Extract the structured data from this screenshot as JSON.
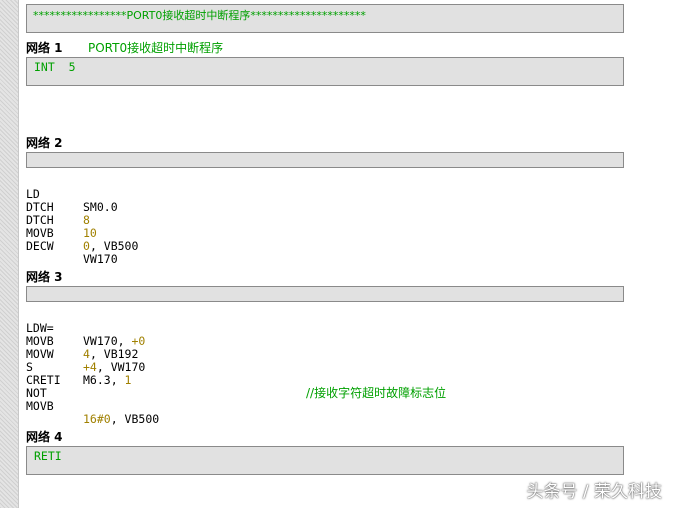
{
  "title_comment": "*****************PORT0接收超时中断程序*********************",
  "networks": [
    {
      "label": "网络 1",
      "comment": "PORT0接收超时中断程序",
      "box_text": "INT  5",
      "lines": []
    },
    {
      "label": "网络 2",
      "comment": "",
      "box_text": "",
      "lines": [
        {
          "op": "LD",
          "arg": "SM0.0"
        },
        {
          "op": "DTCH",
          "arg": "8"
        },
        {
          "op": "DTCH",
          "arg": "10"
        },
        {
          "op": "MOVB",
          "arg_num": "0",
          "arg_rest": ", VB500"
        },
        {
          "op": "DECW",
          "arg": "VW170"
        }
      ]
    },
    {
      "label": "网络 3",
      "comment": "",
      "box_text": "",
      "lines": [
        {
          "op": "LDW=",
          "arg_a": "VW170, ",
          "arg_b": "+0"
        },
        {
          "op": "MOVB",
          "arg_num": "4",
          "arg_rest": ", VB192"
        },
        {
          "op": "MOVW",
          "arg_num": "+4",
          "arg_rest": ", VW170"
        },
        {
          "op": "S",
          "arg_a": "M6.3, ",
          "arg_b": "1",
          "comment": "//接收字符超时故障标志位"
        },
        {
          "op": "CRETI",
          "arg": ""
        },
        {
          "op": "NOT",
          "arg": ""
        },
        {
          "op": "MOVB",
          "arg_num": "16#0",
          "arg_rest": ", VB500"
        }
      ]
    },
    {
      "label": "网络 4",
      "comment": "",
      "box_text": "RETI",
      "lines": []
    }
  ],
  "watermark": "头条号 / 荣久科技",
  "colors": {
    "comment_green": "#00a000",
    "constant_olive": "#a08000",
    "box_gray": "#e1e1e1"
  }
}
